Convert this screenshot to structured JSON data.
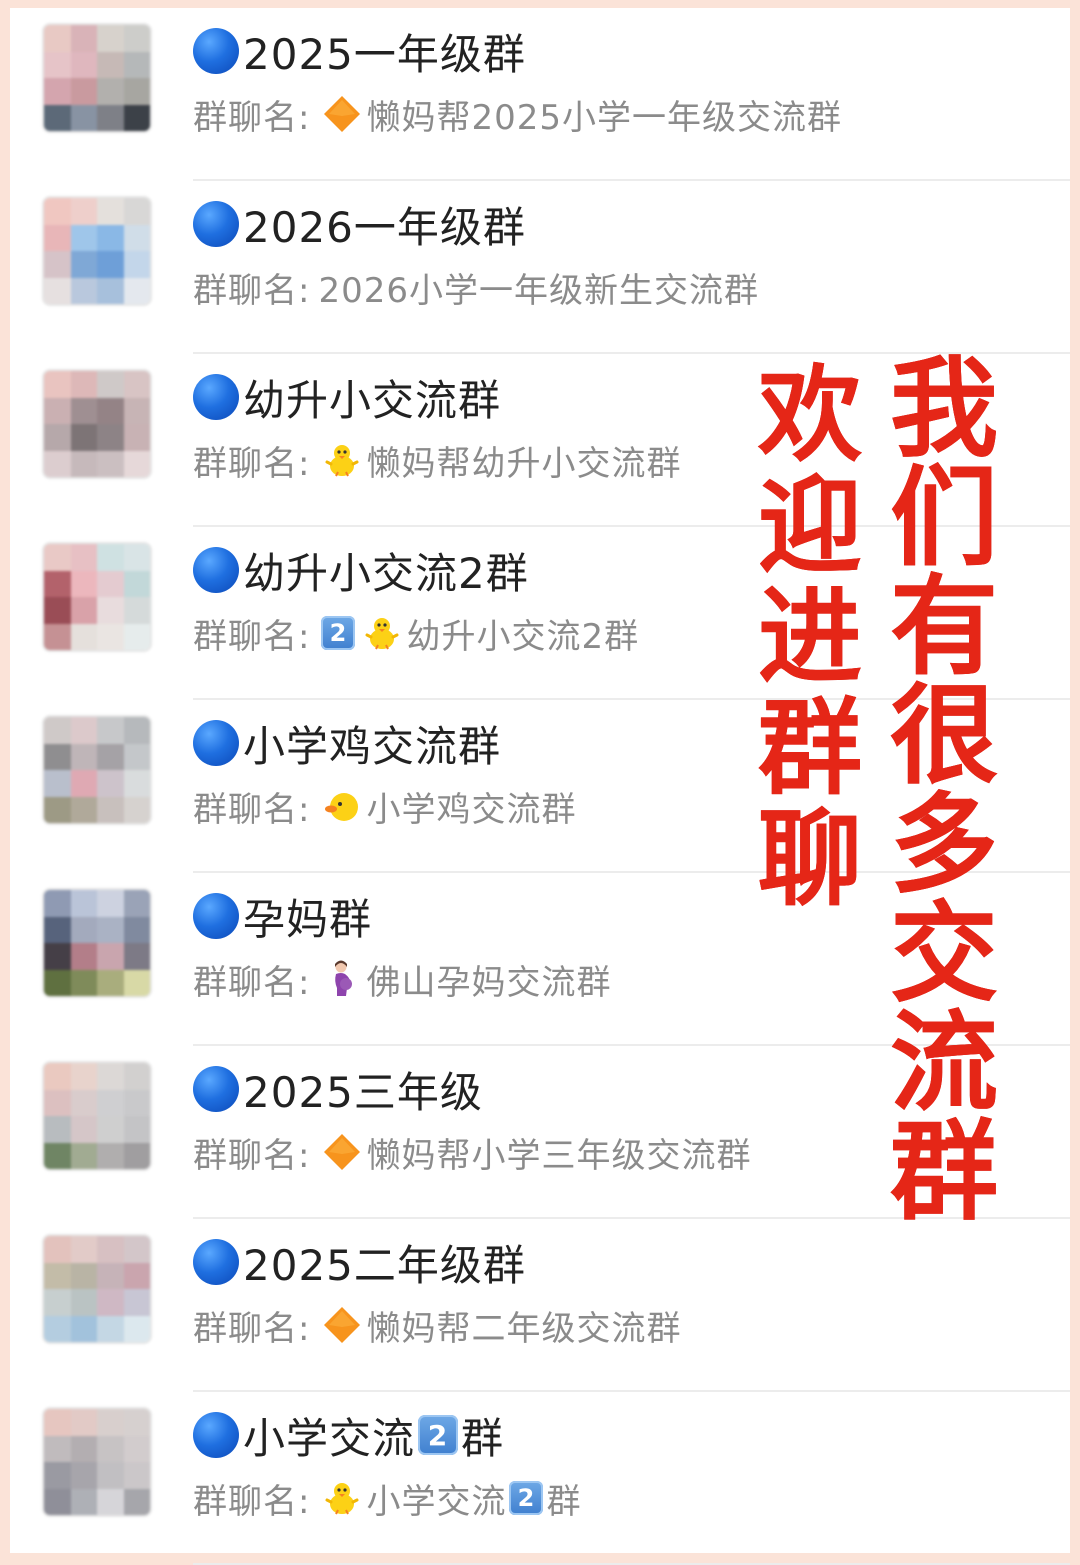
{
  "rows": [
    {
      "title": "2025一年级群",
      "label": "群聊名:",
      "name": "懒妈帮2025小学一年级交流群",
      "icon": "orange-diamond-icon",
      "colors": [
        "#e8c9c4",
        "#d9b3b8",
        "#d7d2cc",
        "#cdcdca",
        "#e6c4c8",
        "#dfb7be",
        "#c6b9b6",
        "#b5b8b9",
        "#d4a5ae",
        "#c99a9f",
        "#b2b0ad",
        "#a7a6a1",
        "#5c6978",
        "#8893a3",
        "#7e8087",
        "#3c4148"
      ]
    },
    {
      "title": "2026一年级群",
      "label": "群聊名:",
      "name": "2026小学一年级新生交流群",
      "icon": "",
      "colors": [
        "#f0c7c1",
        "#eecfcb",
        "#e4e0dc",
        "#d8d7d6",
        "#e8b6b8",
        "#9fc6ea",
        "#8ab8e6",
        "#d0dde8",
        "#d6c3c8",
        "#7fa8d6",
        "#6e9fd8",
        "#c3d6ea",
        "#e6e0e0",
        "#b9c8dd",
        "#a7c0dc",
        "#e4e8ee"
      ]
    },
    {
      "title": "幼升小交流群",
      "label": "群聊名:",
      "name": "懒妈帮幼升小交流群",
      "icon": "chick-icon",
      "colors": [
        "#e9c4c0",
        "#ddb8b8",
        "#cfc9c8",
        "#d8c4c4",
        "#cab0b2",
        "#9f8f92",
        "#948386",
        "#c7b4b5",
        "#b6a8aa",
        "#7d7476",
        "#8d8386",
        "#c8b2b4",
        "#dccdcf",
        "#c6b9bb",
        "#cbbfc1",
        "#e6d8d9"
      ]
    },
    {
      "title": "幼升小交流2群",
      "label": "群聊名:",
      "name": "幼升小交流2群",
      "icon": "keycap-2-chick-icon",
      "colors": [
        "#e9c9c6",
        "#e7c0c4",
        "#cfe1e2",
        "#d9e4e6",
        "#b3626b",
        "#ecb7bd",
        "#e4cbd0",
        "#c2d8d9",
        "#9a4d56",
        "#d9a2a9",
        "#e8dcdd",
        "#d5dada",
        "#c59194",
        "#e5e0dc",
        "#eae5e2",
        "#e6ecec"
      ]
    },
    {
      "title": "小学鸡交流群",
      "label": "群聊名:",
      "name": "小学鸡交流群",
      "icon": "duck-icon",
      "colors": [
        "#cfc9c8",
        "#dcc9cb",
        "#c7c8ca",
        "#b6b9bc",
        "#8f8e90",
        "#bfb5b8",
        "#a5a2a6",
        "#c4c7ca",
        "#b9bfcc",
        "#dfa9b3",
        "#cdc3cb",
        "#d9dcdd",
        "#9d9a85",
        "#b0a99a",
        "#c8c0bd",
        "#d6d2cf"
      ]
    },
    {
      "title": "孕妈群",
      "label": "群聊名:",
      "name": "佛山孕妈交流群",
      "icon": "pregnant-woman-icon",
      "colors": [
        "#8f9ab3",
        "#bac4d8",
        "#cdd2e0",
        "#9aa3b7",
        "#57637c",
        "#a3aabd",
        "#aab2c4",
        "#808a9f",
        "#453f47",
        "#b37e89",
        "#c9a5ae",
        "#7d7a86",
        "#5f7040",
        "#7f8b5a",
        "#a9ad7d",
        "#d8d9a6"
      ]
    },
    {
      "title": "2025三年级",
      "label": "群聊名:",
      "name": "懒妈帮小学三年级交流群",
      "icon": "orange-diamond-icon",
      "colors": [
        "#eac9c0",
        "#e8d3cc",
        "#dcd8d6",
        "#d2d0cf",
        "#dcc0c0",
        "#d9cccc",
        "#cfcfd1",
        "#c9c9cb",
        "#b8bcbf",
        "#d5c6c8",
        "#cfcfcf",
        "#c4c4c6",
        "#6f8564",
        "#a1ab92",
        "#b0aeae",
        "#a09ea0"
      ]
    },
    {
      "title": "2025二年级群",
      "label": "群聊名:",
      "name": "懒妈帮二年级交流群",
      "icon": "orange-diamond-icon",
      "colors": [
        "#e3c2bd",
        "#e2cbc8",
        "#d7c0c2",
        "#d3c6c9",
        "#c3bca8",
        "#b9b4a5",
        "#c6b3b8",
        "#caa5ae",
        "#c7cfcf",
        "#bac3c3",
        "#cfb8c4",
        "#c8c6d4",
        "#b4cde0",
        "#a2c2dc",
        "#c4d7e4",
        "#dce8ee"
      ]
    },
    {
      "title": "小学交流2群",
      "label": "群聊名:",
      "name": "小学交流2群",
      "icon": "chick-icon",
      "colors": [
        "#e6c6c0",
        "#e2cac6",
        "#d8cfcd",
        "#d6d0cf",
        "#c0bbbd",
        "#b3aeb1",
        "#c7c3c4",
        "#d2cccd",
        "#9a9aa2",
        "#a7a5ab",
        "#c1bfc2",
        "#cbc7c9",
        "#8f8f99",
        "#aeb0b6",
        "#d6d5d9",
        "#a6a6ab"
      ]
    }
  ],
  "overlay": {
    "left_text": [
      "欢",
      "迎",
      "进",
      "群",
      "聊"
    ],
    "right_text": [
      "我",
      "们",
      "有",
      "很",
      "多",
      "交",
      "流",
      "群"
    ],
    "color": "#e52617"
  },
  "icons": {
    "orange_diamond": "orange-diamond-icon",
    "chick": "chick-icon",
    "duck": "duck-icon",
    "pregnant": "pregnant-woman-icon",
    "keycap_two": "2"
  }
}
